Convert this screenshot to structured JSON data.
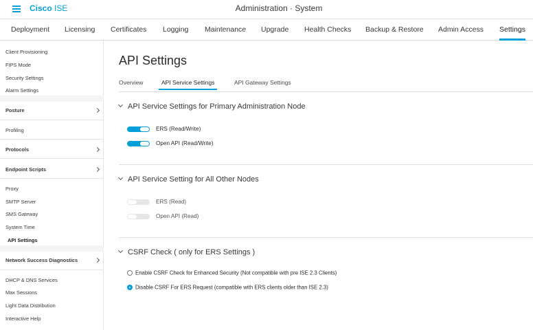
{
  "app": {
    "brand_bold": "Cisco",
    "brand_light": " ISE",
    "context": "Administration · System"
  },
  "nav": {
    "tabs": [
      {
        "label": "Deployment"
      },
      {
        "label": "Licensing"
      },
      {
        "label": "Certificates"
      },
      {
        "label": "Logging"
      },
      {
        "label": "Maintenance"
      },
      {
        "label": "Upgrade"
      },
      {
        "label": "Health Checks"
      },
      {
        "label": "Backup & Restore"
      },
      {
        "label": "Admin Access"
      },
      {
        "label": "Settings",
        "active": true
      }
    ]
  },
  "sidebar": {
    "items": [
      {
        "label": "Client Provisioning"
      },
      {
        "label": "FIPS Mode"
      },
      {
        "label": "Security Settings"
      },
      {
        "label": "Alarm Settings"
      },
      {
        "label": "Posture",
        "group": true
      },
      {
        "label": "Profiling"
      },
      {
        "label": "Protocols",
        "group": true
      },
      {
        "label": "Endpoint Scripts",
        "group": true
      },
      {
        "label": "Proxy"
      },
      {
        "label": "SMTP Server"
      },
      {
        "label": "SMS Gateway"
      },
      {
        "label": "System Time"
      },
      {
        "label": "API Settings",
        "active": true
      },
      {
        "label": "Network Success Diagnostics",
        "group": true
      },
      {
        "label": "DHCP & DNS Services"
      },
      {
        "label": "Max Sessions"
      },
      {
        "label": "Light Data Distribution"
      },
      {
        "label": "Interactive Help"
      }
    ]
  },
  "main": {
    "title": "API Settings",
    "subtabs": [
      {
        "label": "Overview"
      },
      {
        "label": "API Service Settings",
        "active": true
      },
      {
        "label": "API Gateway Settings"
      }
    ],
    "section1": {
      "title": "API Service Settings for Primary Administration Node",
      "toggles": [
        {
          "label": "ERS (Read/Write)",
          "on": true
        },
        {
          "label": "Open API (Read/Write)",
          "on": true
        }
      ]
    },
    "section2": {
      "title": "API Service Setting for All Other Nodes",
      "toggles": [
        {
          "label": "ERS (Read)",
          "on": false
        },
        {
          "label": "Open API (Read)",
          "on": false
        }
      ]
    },
    "section3": {
      "title": "CSRF Check ( only for ERS Settings )",
      "options": [
        {
          "label": "Enable CSRF Check for Enhanced Security (Not compatible with pre ISE 2.3 Clients)",
          "selected": false
        },
        {
          "label": "Disable CSRF For ERS Request (compatible with ERS clients older than ISE 2.3)",
          "selected": true
        }
      ]
    }
  },
  "colors": {
    "accent": "#049fd9",
    "toggle_off": "#e6e6e6"
  }
}
